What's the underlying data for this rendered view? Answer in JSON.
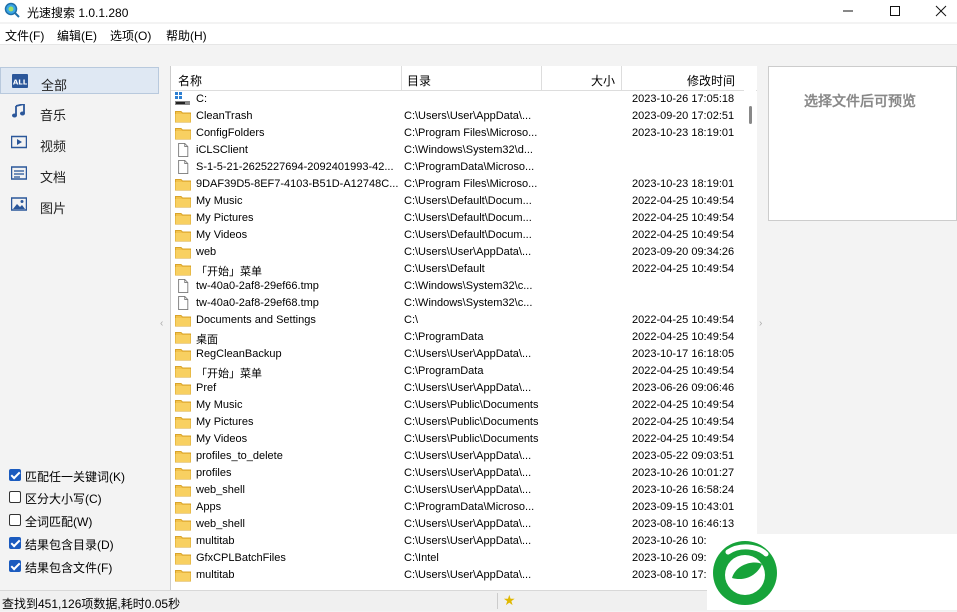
{
  "window": {
    "title": "光速搜索 1.0.1.280"
  },
  "menu": [
    "文件(F)",
    "编辑(E)",
    "选项(O)",
    "帮助(H)"
  ],
  "sidebar": {
    "items": [
      {
        "label": "全部",
        "icon": "all-icon",
        "active": true
      },
      {
        "label": "音乐",
        "icon": "music-note-icon"
      },
      {
        "label": "视频",
        "icon": "video-icon"
      },
      {
        "label": "文档",
        "icon": "document-icon"
      },
      {
        "label": "图片",
        "icon": "picture-icon"
      }
    ],
    "options": [
      {
        "label": "匹配任一关键词(K)",
        "checked": true
      },
      {
        "label": "区分大小写(C)",
        "checked": false
      },
      {
        "label": "全词匹配(W)",
        "checked": false
      },
      {
        "label": "结果包含目录(D)",
        "checked": true
      },
      {
        "label": "结果包含文件(F)",
        "checked": true
      }
    ]
  },
  "table": {
    "columns": {
      "name": "名称",
      "dir": "目录",
      "size": "大小",
      "time": "修改时间"
    },
    "rows": [
      {
        "icon": "drive",
        "name": "C:",
        "dir": "",
        "time": "2023-10-26 17:05:18"
      },
      {
        "icon": "folder",
        "name": "CleanTrash",
        "dir": "C:\\Users\\User\\AppData\\...",
        "time": "2023-09-20 17:02:51"
      },
      {
        "icon": "folder",
        "name": "ConfigFolders",
        "dir": "C:\\Program Files\\Microso...",
        "time": "2023-10-23 18:19:01"
      },
      {
        "icon": "file",
        "name": "iCLSClient",
        "dir": "C:\\Windows\\System32\\d...",
        "time": ""
      },
      {
        "icon": "file",
        "name": "S-1-5-21-2625227694-2092401993-42...",
        "dir": "C:\\ProgramData\\Microso...",
        "time": ""
      },
      {
        "icon": "folder",
        "name": "9DAF39D5-8EF7-4103-B51D-A12748C...",
        "dir": "C:\\Program Files\\Microso...",
        "time": "2023-10-23 18:19:01"
      },
      {
        "icon": "folder",
        "name": "My Music",
        "dir": "C:\\Users\\Default\\Docum...",
        "time": "2022-04-25 10:49:54"
      },
      {
        "icon": "folder",
        "name": "My Pictures",
        "dir": "C:\\Users\\Default\\Docum...",
        "time": "2022-04-25 10:49:54"
      },
      {
        "icon": "folder",
        "name": "My Videos",
        "dir": "C:\\Users\\Default\\Docum...",
        "time": "2022-04-25 10:49:54"
      },
      {
        "icon": "folder",
        "name": "web",
        "dir": "C:\\Users\\User\\AppData\\...",
        "time": "2023-09-20 09:34:26"
      },
      {
        "icon": "folder",
        "name": "「开始」菜单",
        "dir": "C:\\Users\\Default",
        "time": "2022-04-25 10:49:54"
      },
      {
        "icon": "file",
        "name": "tw-40a0-2af8-29ef66.tmp",
        "dir": "C:\\Windows\\System32\\c...",
        "time": ""
      },
      {
        "icon": "file",
        "name": "tw-40a0-2af8-29ef68.tmp",
        "dir": "C:\\Windows\\System32\\c...",
        "time": ""
      },
      {
        "icon": "folder",
        "name": "Documents and Settings",
        "dir": "C:\\",
        "time": "2022-04-25 10:49:54"
      },
      {
        "icon": "folder",
        "name": "桌面",
        "dir": "C:\\ProgramData",
        "time": "2022-04-25 10:49:54"
      },
      {
        "icon": "folder",
        "name": "RegCleanBackup",
        "dir": "C:\\Users\\User\\AppData\\...",
        "time": "2023-10-17 16:18:05"
      },
      {
        "icon": "folder",
        "name": "「开始」菜单",
        "dir": "C:\\ProgramData",
        "time": "2022-04-25 10:49:54"
      },
      {
        "icon": "folder",
        "name": "Pref",
        "dir": "C:\\Users\\User\\AppData\\...",
        "time": "2023-06-26 09:06:46"
      },
      {
        "icon": "folder",
        "name": "My Music",
        "dir": "C:\\Users\\Public\\Documents",
        "time": "2022-04-25 10:49:54"
      },
      {
        "icon": "folder",
        "name": "My Pictures",
        "dir": "C:\\Users\\Public\\Documents",
        "time": "2022-04-25 10:49:54"
      },
      {
        "icon": "folder",
        "name": "My Videos",
        "dir": "C:\\Users\\Public\\Documents",
        "time": "2022-04-25 10:49:54"
      },
      {
        "icon": "folder",
        "name": "profiles_to_delete",
        "dir": "C:\\Users\\User\\AppData\\...",
        "time": "2023-05-22 09:03:51"
      },
      {
        "icon": "folder",
        "name": "profiles",
        "dir": "C:\\Users\\User\\AppData\\...",
        "time": "2023-10-26 10:01:27"
      },
      {
        "icon": "folder",
        "name": "web_shell",
        "dir": "C:\\Users\\User\\AppData\\...",
        "time": "2023-10-26 16:58:24"
      },
      {
        "icon": "folder",
        "name": "Apps",
        "dir": "C:\\ProgramData\\Microso...",
        "time": "2023-09-15 10:43:01"
      },
      {
        "icon": "folder",
        "name": "web_shell",
        "dir": "C:\\Users\\User\\AppData\\...",
        "time": "2023-08-10 16:46:13"
      },
      {
        "icon": "folder",
        "name": "multitab",
        "dir": "C:\\Users\\User\\AppData\\...",
        "time": "2023-10-26 10:01:25"
      },
      {
        "icon": "folder",
        "name": "GfxCPLBatchFiles",
        "dir": "C:\\Intel",
        "time": "2023-10-26 09:"
      },
      {
        "icon": "folder",
        "name": "multitab",
        "dir": "C:\\Users\\User\\AppData\\...",
        "time": "2023-08-10 17:0"
      }
    ]
  },
  "preview": {
    "text": "选择文件后可预览"
  },
  "status": {
    "text": "查找到451,126项数据,耗时0.05秒"
  },
  "colors": {
    "accent": "#1b5bbf",
    "folder": "#f3c24a",
    "logo_green": "#17a33a"
  }
}
